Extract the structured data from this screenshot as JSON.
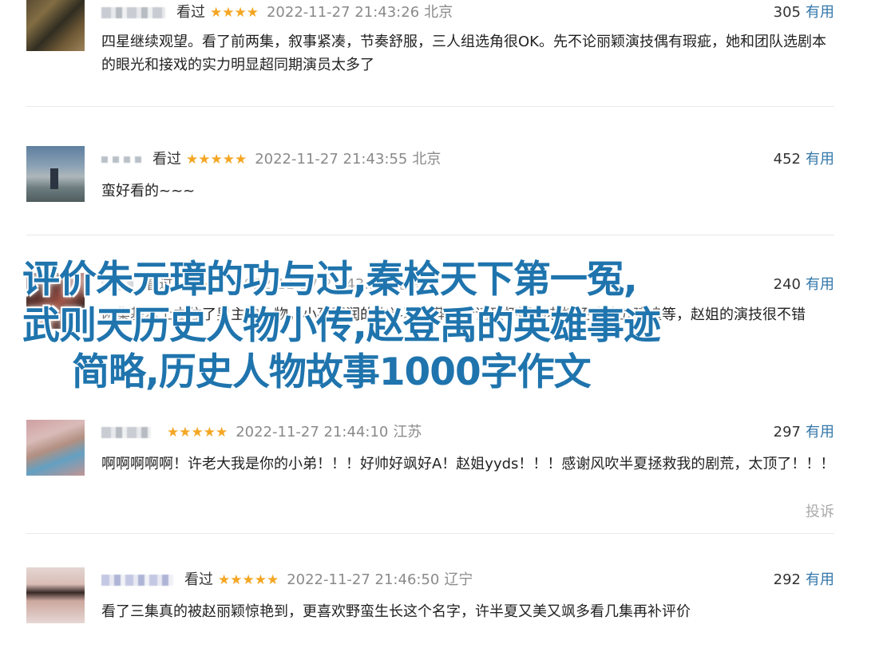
{
  "comments": [
    {
      "status": "看过",
      "stars": "★★★★",
      "time": "2022-11-27 21:43:26",
      "location": "北京",
      "votes": "305",
      "vote_label": "有用",
      "text": "四星继续观望。看了前两集，叙事紧凑，节奏舒服，三人组选角很OK。先不论丽颖演技偶有瑕疵，她和团队选剧本的眼光和接戏的实力明显超同期演员太多了"
    },
    {
      "status": "看过",
      "stars": "★★★★★",
      "time": "2022-11-27 21:43:55",
      "location": "北京",
      "votes": "452",
      "vote_label": "有用",
      "text": "蛮好看的~~~"
    },
    {
      "status": "看过",
      "stars": "★★★★",
      "time": "2022-11-27 21:43:57",
      "location": "北京",
      "votes": "240",
      "vote_label": "有用",
      "text": "两集基本上立住了男主的人物，小孩圆润的许半夏，莽撞听话又怀疑的老板还清算五建追等，赵姐的演技很不错"
    },
    {
      "status": "",
      "stars": "★★★★★",
      "time": "2022-11-27 21:44:10",
      "location": "江苏",
      "votes": "297",
      "vote_label": "有用",
      "text": "啊啊啊啊啊！许老大我是你的小弟！！！好帅好飒好A！赵姐yyds！！！感谢风吹半夏拯救我的剧荒，太顶了！！！",
      "report": "投诉"
    },
    {
      "status": "看过",
      "stars": "★★★★★",
      "time": "2022-11-27 21:46:50",
      "location": "辽宁",
      "votes": "292",
      "vote_label": "有用",
      "text": "看了三集真的被赵丽颖惊艳到，更喜欢野蛮生长这个名字，许半夏又美又飒多看几集再补评价"
    }
  ],
  "overlay": {
    "line1": "评价朱元璋的功与过,秦桧天下第一冤,",
    "line2": "武则天历史人物小传,赵登禹的英雄事迹",
    "line3": "简略,历史人物故事1000字作文"
  },
  "colors": {
    "star": "#f4a623",
    "link": "#3377aa",
    "overlay": "#1f74ad",
    "time": "#8a8a8a"
  }
}
